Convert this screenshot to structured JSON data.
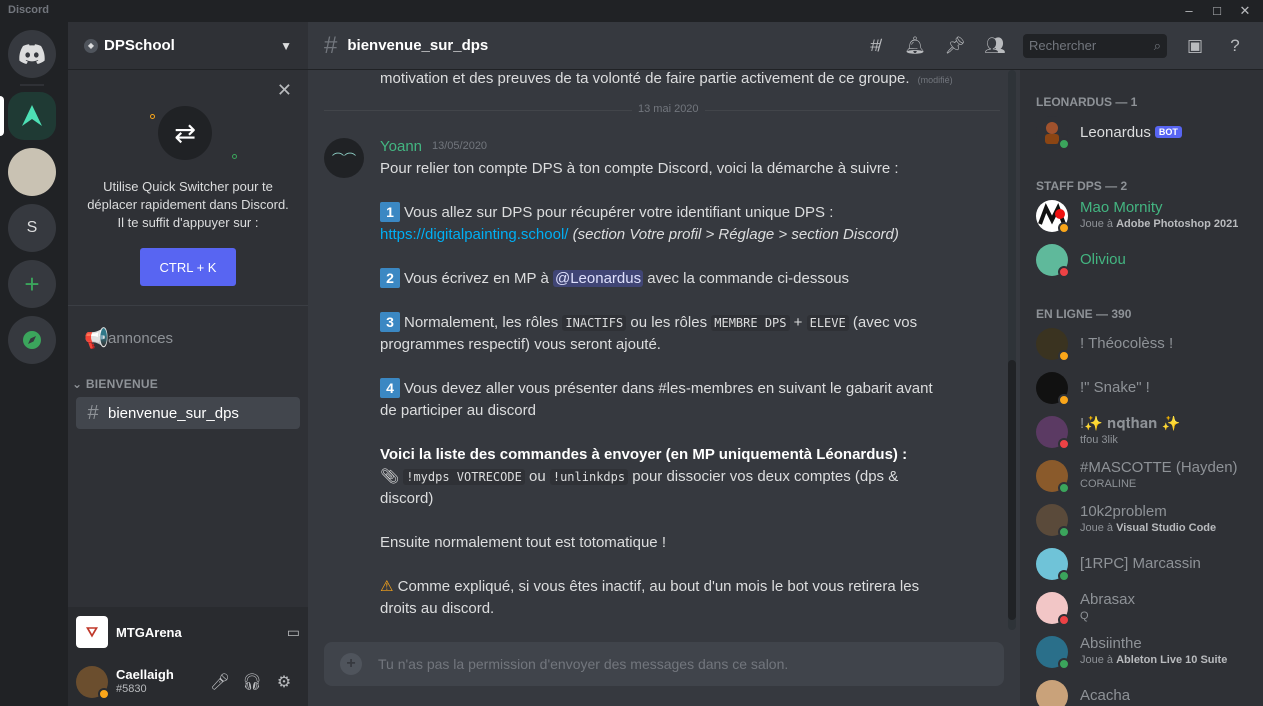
{
  "app": {
    "title": "Discord"
  },
  "server": {
    "name": "DPSchool"
  },
  "quick_switcher": {
    "text": "Utilise Quick Switcher pour te déplacer rapidement dans Discord. Il te suffit d'appuyer sur :",
    "button": "CTRL + K"
  },
  "channels": {
    "announcements": "annonces",
    "category": "BIENVENUE",
    "active": "bienvenue_sur_dps"
  },
  "activity": {
    "name": "MTGArena"
  },
  "user": {
    "name": "Caellaigh",
    "tag": "#5830"
  },
  "topbar": {
    "channel": "bienvenue_sur_dps",
    "search_placeholder": "Rechercher"
  },
  "messages": {
    "previous_line": "motivation et des preuves de ta volonté de faire partie activement de ce groupe.",
    "edited": "(modifié)",
    "date_divider": "13 mai 2020",
    "author": "Yoann",
    "timestamp": "13/05/2020",
    "intro": "Pour relier ton compte DPS à ton compte Discord, voici la démarche à suivre :",
    "step1_text": "Vous allez sur DPS pour récupérer votre identifiant unique DPS :",
    "step1_link": "https://digitalpainting.school/",
    "step1_italic": "(section Votre profil > Réglage > section Discord)",
    "step2_pre": "Vous écrivez en MP à",
    "step2_mention": "@Leonardus",
    "step2_post": "avec la commande ci-dessous",
    "step3_pre": "Normalement, les rôles",
    "step3_code1": "INACTIFS",
    "step3_mid": "ou les rôles",
    "step3_code2": "MEMBRE DPS",
    "step3_plus": "+",
    "step3_code3": "ELEVE",
    "step3_post": "(avec vos programmes respectif) vous seront ajouté.",
    "step4_text": "Vous devez aller vous présenter dans #les-membres en suivant le gabarit avant de participer au discord",
    "list_title": "Voici la liste des commandes à envoyer (en MP uniquementà Léonardus) :",
    "cmd1": "!mydps VOTRECODE",
    "cmd_or": "ou",
    "cmd2": "!unlinkdps",
    "cmd_post": "pour dissocier vos deux comptes (dps & discord)",
    "auto": "Ensuite normalement tout est totomatique !",
    "warning": "Comme expliqué, si vous êtes inactif, au bout d'un mois le bot vous retirera les droits au discord."
  },
  "composer": {
    "placeholder": "Tu n'as pas la permission d'envoyer des messages dans ce salon."
  },
  "members": {
    "cat_leonardus": "LEONARDUS — 1",
    "cat_staff": "STAFF DPS — 2",
    "cat_online": "EN LIGNE — 390",
    "bot_tag": "BOT",
    "list": [
      {
        "name": "Leonardus",
        "sub": ""
      },
      {
        "name": "Mao Mornity",
        "sub_pre": "Joue à",
        "sub_game": "Adobe Photoshop 2021"
      },
      {
        "name": "Oliviou",
        "sub": ""
      },
      {
        "name": "! Théocolèss !",
        "sub": ""
      },
      {
        "name": "!\" Snake\" !",
        "sub": ""
      },
      {
        "name": "!✨ 𝐧𝐪𝐭𝐡𝐚𝐧 ✨",
        "sub": "tfou 3lik"
      },
      {
        "name": "#MASCOTTE (Hayden)",
        "sub": "CORALINE"
      },
      {
        "name": "10k2problem",
        "sub_pre": "Joue à",
        "sub_game": "Visual Studio Code"
      },
      {
        "name": "[1RPC] Marcassin",
        "sub": ""
      },
      {
        "name": "Abrasax",
        "sub": "Q"
      },
      {
        "name": "Absiinthe",
        "sub_pre": "Joue à",
        "sub_game": "Ableton Live 10 Suite"
      },
      {
        "name": "Acacha",
        "sub": ""
      }
    ]
  },
  "colors": {
    "accent": "#5865f2",
    "online": "#3ba55c",
    "idle": "#faa61a",
    "dnd": "#ed4245",
    "staff": "#43b581"
  }
}
